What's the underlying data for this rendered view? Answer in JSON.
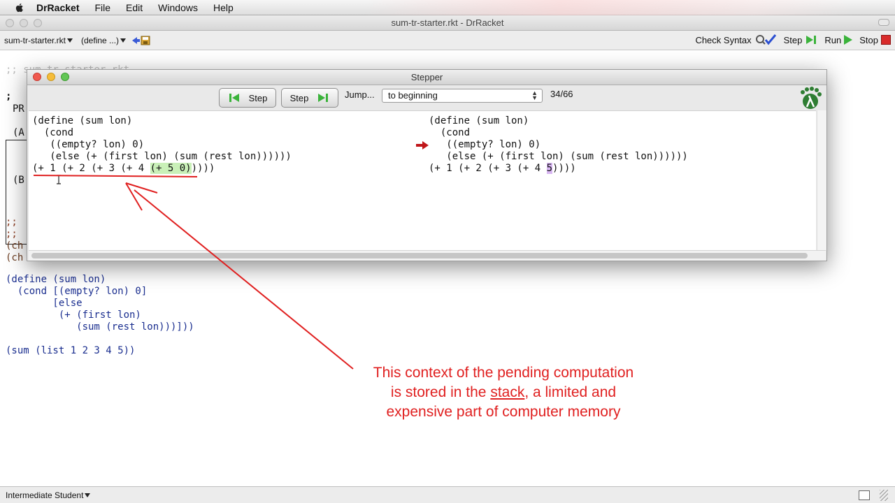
{
  "menubar": {
    "app": "DrRacket",
    "items": [
      "File",
      "Edit",
      "Windows",
      "Help"
    ]
  },
  "window": {
    "title": "sum-tr-starter.rkt - DrRacket"
  },
  "toolbar": {
    "file_dropdown": "sum-tr-starter.rkt",
    "define_dropdown": "(define ...)",
    "check_syntax": "Check Syntax",
    "step": "Step",
    "run": "Run",
    "stop": "Stop"
  },
  "definitions": {
    "top_comment": ";; sum-tr-starter.rkt",
    "box_lines": [
      ";",
      "PR",
      "(A",
      "(B"
    ],
    "mid_lines": [
      ";;",
      ";; ",
      "(ch",
      "(ch"
    ],
    "code_lines": [
      "(define (sum lon)",
      "  (cond [(empty? lon) 0]",
      "        [else",
      "         (+ (first lon)",
      "            (sum (rest lon)))]))",
      "",
      "(sum (list 1 2 3 4 5))"
    ]
  },
  "stepper": {
    "title": "Stepper",
    "back_button": "Step",
    "forward_button": "Step",
    "jump_label": "Jump...",
    "jump_value": "to beginning",
    "counter": "34/66",
    "left_code": [
      "(define (sum lon)",
      "  (cond",
      "   ((empty? lon) 0)",
      "   (else (+ (first lon) (sum (rest lon))))))"
    ],
    "left_expr_prefix": "(+ 1 (+ 2 (+ 3 (+ 4 ",
    "left_expr_hl": "(+ 5 0)",
    "left_expr_suffix": "))))",
    "right_code": [
      "(define (sum lon)",
      "  (cond",
      "   ((empty? lon) 0)",
      "   (else (+ (first lon) (sum (rest lon))))))"
    ],
    "right_expr_prefix": "(+ 1 (+ 2 (+ 3 (+ 4 ",
    "right_expr_hl": "5",
    "right_expr_suffix": "))))"
  },
  "annotation": {
    "line1": "This context of the pending computation",
    "line2_pre": "is stored in the ",
    "line2_underline": "stack",
    "line2_post": ", a limited and",
    "line3": "expensive part of computer memory",
    "color": "#e02020"
  },
  "statusbar": {
    "language": "Intermediate Student"
  }
}
